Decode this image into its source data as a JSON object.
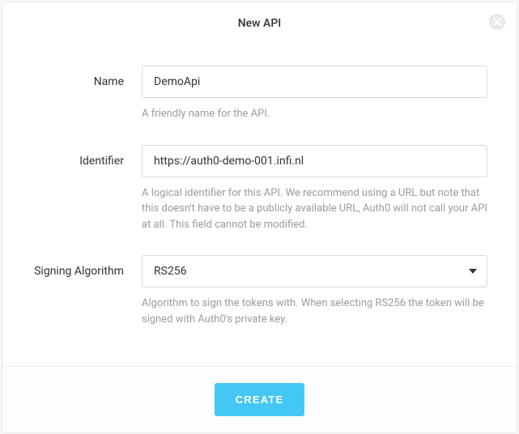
{
  "modal": {
    "title": "New API",
    "fields": {
      "name": {
        "label": "Name",
        "value": "DemoApi",
        "help": "A friendly name for the API."
      },
      "identifier": {
        "label": "Identifier",
        "value": "https://auth0-demo-001.infi.nl",
        "help": "A logical identifier for this API. We recommend using a URL but note that this doesn't have to be a publicly available URL, Auth0 will not call your API at all. This field cannot be modified."
      },
      "algorithm": {
        "label": "Signing Algorithm",
        "value": "RS256",
        "help": "Algorithm to sign the tokens with. When selecting RS256 the token will be signed with Auth0's private key."
      }
    },
    "footer": {
      "create_label": "CREATE"
    }
  }
}
